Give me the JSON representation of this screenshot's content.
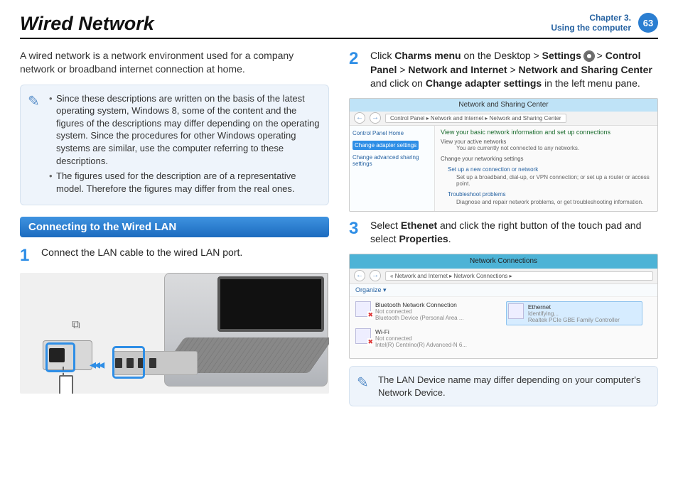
{
  "header": {
    "title": "Wired Network",
    "chapter_line1": "Chapter 3.",
    "chapter_line2": "Using the computer",
    "page_number": "63"
  },
  "left": {
    "intro": "A wired network is a network environment used for a company network or broadband internet connection at home.",
    "note_bullet1": "Since these descriptions are written on the basis of the latest operating system, Windows 8, some of the content and the figures of the descriptions may differ depending on the operating system. Since the procedures for other Windows operating systems are similar, use the computer referring to these descriptions.",
    "note_bullet2": "The figures used for the description are of a representative model. Therefore the figures may differ from the real ones.",
    "section_title": "Connecting to the Wired LAN",
    "step1_num": "1",
    "step1_text": "Connect the LAN cable to the wired LAN port."
  },
  "right": {
    "step2_num": "2",
    "step2_pre": "Click ",
    "step2_b1": "Charms menu",
    "step2_mid1": " on the Desktop > ",
    "step2_b2": "Settings",
    "step2_mid1b": " ",
    "step2_mid2": " > ",
    "step2_b3": "Control Panel",
    "step2_mid3": " > ",
    "step2_b4": "Network and Internet",
    "step2_mid4": " > ",
    "step2_b5": "Network and Sharing Center",
    "step2_mid5": " and click on ",
    "step2_b6": "Change adapter settings",
    "step2_end": " in the left menu pane.",
    "fig2": {
      "title": "Network and Sharing Center",
      "crumb": "Control Panel  ▸  Network and Internet  ▸  Network and Sharing Center",
      "side_home": "Control Panel Home",
      "side_change": "Change adapter settings",
      "side_adv": "Change advanced sharing settings",
      "main_h1": "View your basic network information and set up connections",
      "main_l1": "View your active networks",
      "main_s1": "You are currently not connected to any networks.",
      "main_l2": "Change your networking settings",
      "main_link1": "Set up a new connection or network",
      "main_sub1": "Set up a broadband, dial-up, or VPN connection; or set up a router or access point.",
      "main_link2": "Troubleshoot problems",
      "main_sub2": "Diagnose and repair network problems, or get troubleshooting information."
    },
    "step3_num": "3",
    "step3_pre": "Select ",
    "step3_b1": "Ethenet",
    "step3_mid": " and click the right button of the touch pad and select ",
    "step3_b2": "Properties",
    "step3_end": ".",
    "fig3": {
      "title": "Network Connections",
      "crumb": "«  Network and Internet  ▸  Network Connections  ▸",
      "organize": "Organize ▾",
      "bt_name": "Bluetooth Network Connection",
      "bt_stat": "Not connected",
      "bt_dev": "Bluetooth Device (Personal Area ...",
      "eth_name": "Ethernet",
      "eth_stat": "Identifying...",
      "eth_dev": "Realtek PCIe GBE Family Controller",
      "wifi_name": "Wi-Fi",
      "wifi_stat": "Not connected",
      "wifi_dev": "Intel(R) Centrino(R) Advanced-N 6..."
    },
    "note2": "The LAN Device name may differ depending on your computer's Network Device."
  }
}
